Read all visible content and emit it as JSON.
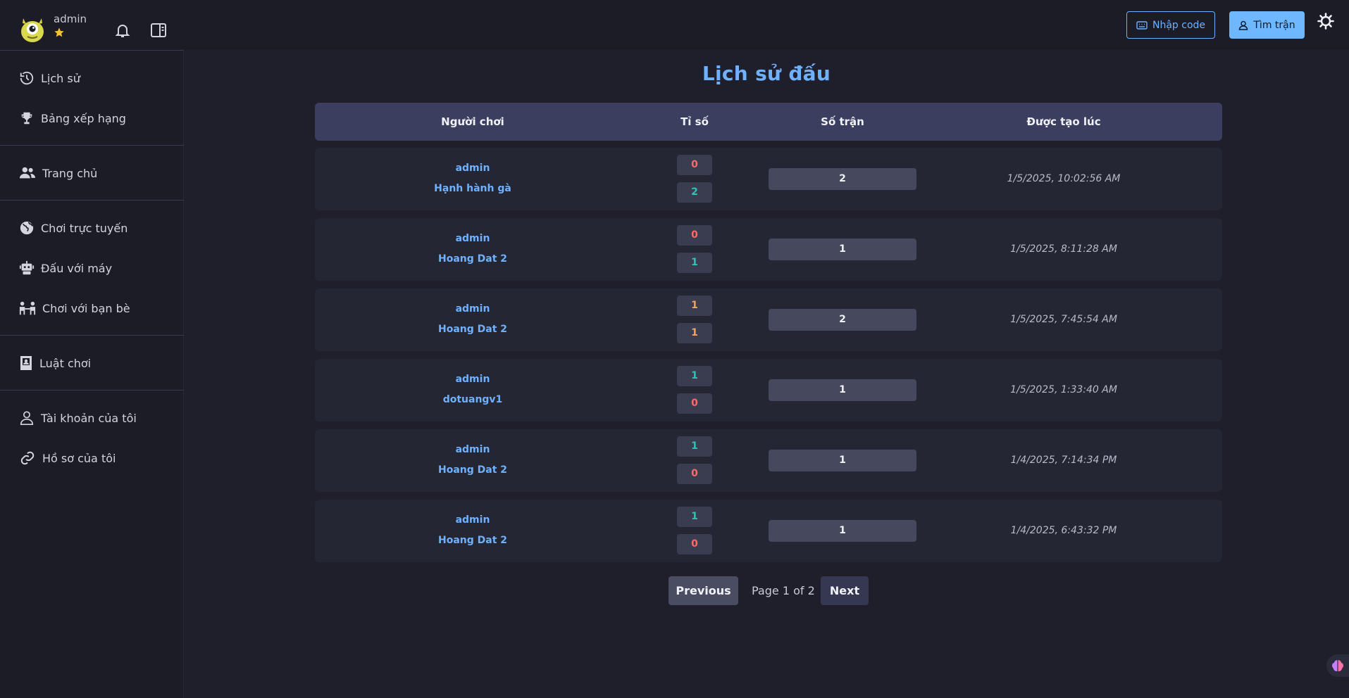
{
  "topbar": {
    "username": "admin",
    "code_button": "Nhập code",
    "find_button": "Tìm trận"
  },
  "sidebar": {
    "items": [
      {
        "label": "Lịch sử",
        "icon": "history-icon"
      },
      {
        "label": "Bảng xếp hạng",
        "icon": "trophy-icon"
      },
      {
        "label": "Trang chủ",
        "icon": "users-icon"
      },
      {
        "label": "Chơi trực tuyến",
        "icon": "globe-icon"
      },
      {
        "label": "Đấu với máy",
        "icon": "robot-icon"
      },
      {
        "label": "Chơi với bạn bè",
        "icon": "friends-icon"
      },
      {
        "label": "Luật chơi",
        "icon": "rulebook-icon"
      },
      {
        "label": "Tài khoản của tôi",
        "icon": "user-icon"
      },
      {
        "label": "Hồ sơ của tôi",
        "icon": "link-icon"
      }
    ]
  },
  "main": {
    "title": "Lịch sử đấu",
    "columns": [
      "Người chơi",
      "Tỉ số",
      "Số trận",
      "Được tạo lúc"
    ],
    "rows": [
      {
        "player1": "admin",
        "player2": "Hạnh hành gà",
        "score1": "0",
        "score2": "2",
        "matches": "2",
        "created": "1/5/2025, 10:02:56 AM"
      },
      {
        "player1": "admin",
        "player2": "Hoang Dat 2",
        "score1": "0",
        "score2": "1",
        "matches": "1",
        "created": "1/5/2025, 8:11:28 AM"
      },
      {
        "player1": "admin",
        "player2": "Hoang Dat 2",
        "score1": "1",
        "score2": "1",
        "matches": "2",
        "created": "1/5/2025, 7:45:54 AM"
      },
      {
        "player1": "admin",
        "player2": "dotuangv1",
        "score1": "1",
        "score2": "0",
        "matches": "1",
        "created": "1/5/2025, 1:33:40 AM"
      },
      {
        "player1": "admin",
        "player2": "Hoang Dat 2",
        "score1": "1",
        "score2": "0",
        "matches": "1",
        "created": "1/4/2025, 7:14:34 PM"
      },
      {
        "player1": "admin",
        "player2": "Hoang Dat 2",
        "score1": "1",
        "score2": "0",
        "matches": "1",
        "created": "1/4/2025, 6:43:32 PM"
      }
    ],
    "pagination": {
      "previous": "Previous",
      "info": "Page 1 of 2",
      "next": "Next"
    }
  },
  "colors": {
    "win": "#2ec4b6",
    "loss": "#ff6b6b",
    "draw": "#f4a261",
    "accent": "#6fb1ff"
  }
}
